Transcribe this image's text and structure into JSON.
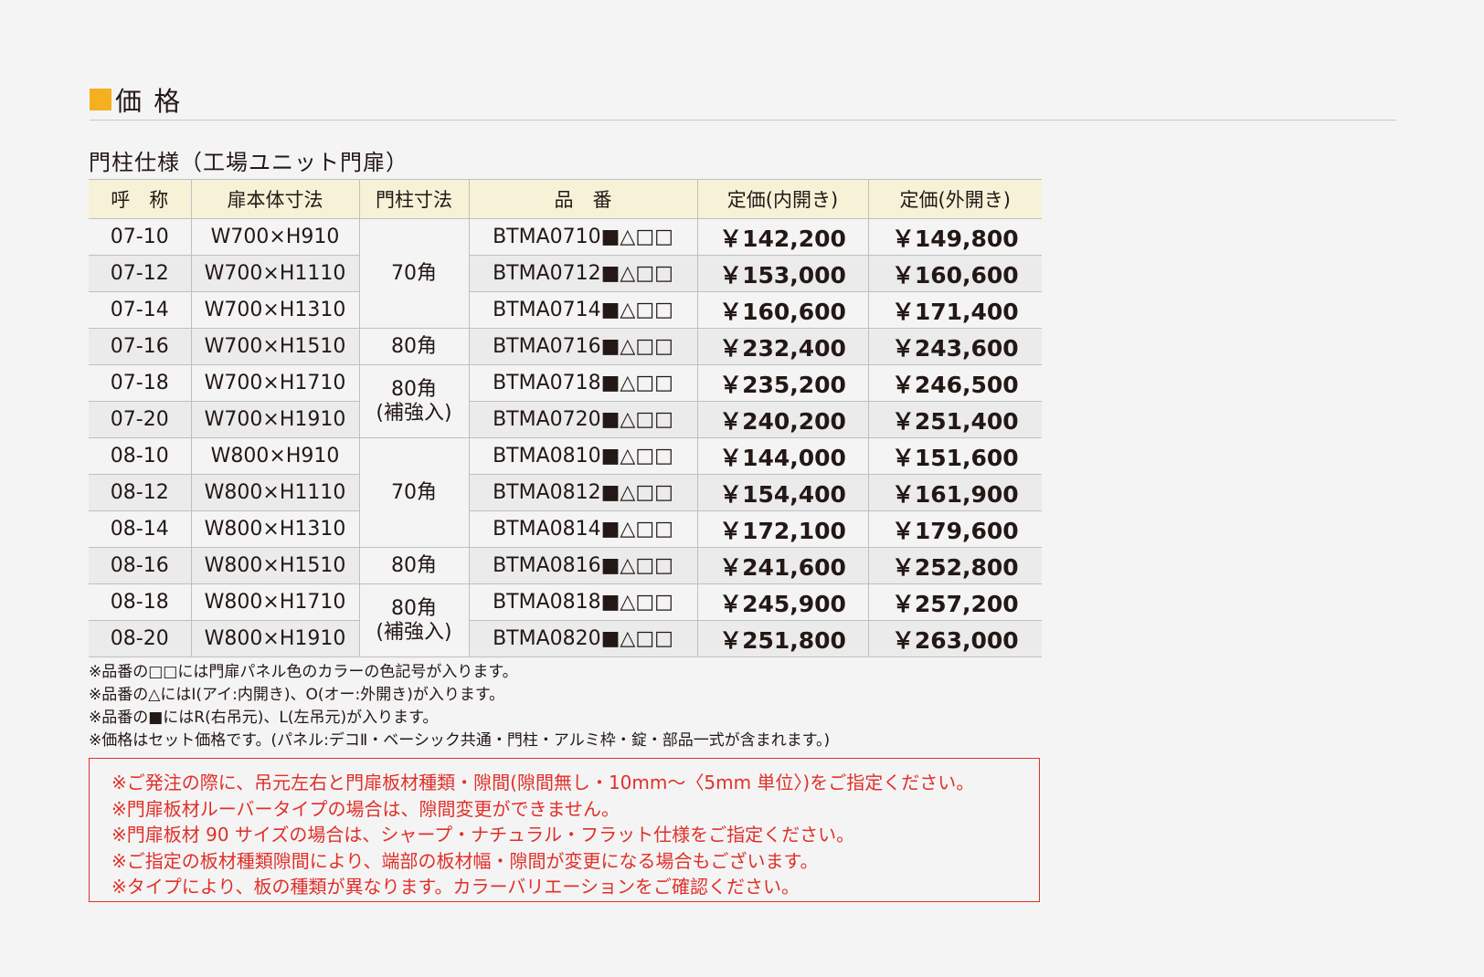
{
  "page": {
    "title": "価 格",
    "subtitle": "門柱仕様（工場ユニット門扉）"
  },
  "table": {
    "headers": [
      "呼　称",
      "扉本体寸法",
      "門柱寸法",
      "品　番",
      "定価(内開き)",
      "定価(外開き)"
    ],
    "rows": [
      {
        "name": "07-10",
        "size": "W700×H910",
        "code": "BTMA0710■△□□",
        "inner": "￥142,200",
        "outer": "￥149,800"
      },
      {
        "name": "07-12",
        "size": "W700×H1110",
        "code": "BTMA0712■△□□",
        "inner": "￥153,000",
        "outer": "￥160,600"
      },
      {
        "name": "07-14",
        "size": "W700×H1310",
        "code": "BTMA0714■△□□",
        "inner": "￥160,600",
        "outer": "￥171,400"
      },
      {
        "name": "07-16",
        "size": "W700×H1510",
        "code": "BTMA0716■△□□",
        "inner": "￥232,400",
        "outer": "￥243,600"
      },
      {
        "name": "07-18",
        "size": "W700×H1710",
        "code": "BTMA0718■△□□",
        "inner": "￥235,200",
        "outer": "￥246,500"
      },
      {
        "name": "07-20",
        "size": "W700×H1910",
        "code": "BTMA0720■△□□",
        "inner": "￥240,200",
        "outer": "￥251,400"
      },
      {
        "name": "08-10",
        "size": "W800×H910",
        "code": "BTMA0810■△□□",
        "inner": "￥144,000",
        "outer": "￥151,600"
      },
      {
        "name": "08-12",
        "size": "W800×H1110",
        "code": "BTMA0812■△□□",
        "inner": "￥154,400",
        "outer": "￥161,900"
      },
      {
        "name": "08-14",
        "size": "W800×H1310",
        "code": "BTMA0814■△□□",
        "inner": "￥172,100",
        "outer": "￥179,600"
      },
      {
        "name": "08-16",
        "size": "W800×H1510",
        "code": "BTMA0816■△□□",
        "inner": "￥241,600",
        "outer": "￥252,800"
      },
      {
        "name": "08-18",
        "size": "W800×H1710",
        "code": "BTMA0818■△□□",
        "inner": "￥245,900",
        "outer": "￥257,200"
      },
      {
        "name": "08-20",
        "size": "W800×H1910",
        "code": "BTMA0820■△□□",
        "inner": "￥251,800",
        "outer": "￥263,000"
      }
    ],
    "post_groups": [
      {
        "label": "70角",
        "label2": ""
      },
      {
        "label": "80角",
        "label2": ""
      },
      {
        "label": "80角",
        "label2": "(補強入)"
      },
      {
        "label": "70角",
        "label2": ""
      },
      {
        "label": "80角",
        "label2": ""
      },
      {
        "label": "80角",
        "label2": "(補強入)"
      }
    ]
  },
  "notes": [
    "※品番の□□には門扉パネル色のカラーの色記号が入ります。",
    "※品番の△にはI(アイ:内開き)、O(オー:外開き)が入ります。",
    "※品番の■にはR(右吊元)、L(左吊元)が入ります。",
    "※価格はセット価格です。(パネル:デコⅡ・ベーシック共通・門柱・アルミ枠・錠・部品一式が含まれます。)"
  ],
  "warnings": [
    "※ご発注の際に、吊元左右と門扉板材種類・隙間(隙間無し・10mm〜〈5mm 単位〉)をご指定ください。",
    "※門扉板材ルーバータイプの場合は、隙間変更ができません。",
    "※門扉板材 90 サイズの場合は、シャープ・ナチュラル・フラット仕様をご指定ください。",
    "※ご指定の板材種類隙間により、端部の板材幅・隙間が変更になる場合もございます。",
    "※タイプにより、板の種類が異なります。カラーバリエーションをご確認ください。"
  ],
  "colors": {
    "accent": "#f5b020",
    "header_bg": "#f6f1d7",
    "warning": "#e0302a"
  }
}
